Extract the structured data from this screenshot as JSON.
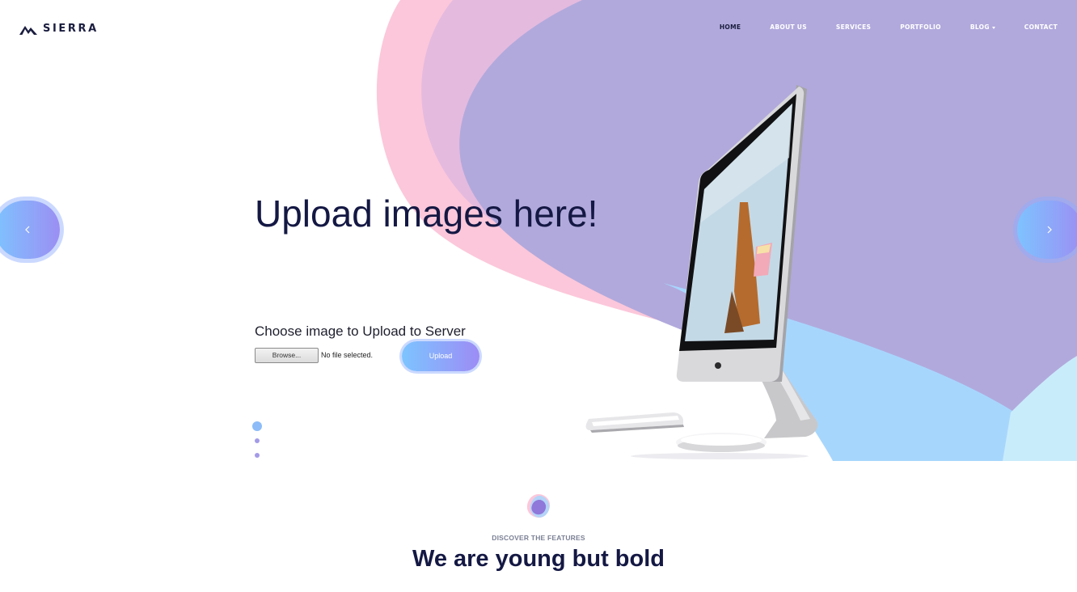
{
  "brand": {
    "name": "SIERRA",
    "logo_icon": "mountain-icon"
  },
  "nav": {
    "items": [
      {
        "label": "HOME",
        "active": true
      },
      {
        "label": "ABOUT US",
        "active": false
      },
      {
        "label": "SERVICES",
        "active": false
      },
      {
        "label": "PORTFOLIO",
        "active": false
      },
      {
        "label": "BLOG",
        "active": false,
        "has_dropdown": true
      },
      {
        "label": "CONTACT",
        "active": false
      }
    ]
  },
  "hero": {
    "title": "Upload images here!",
    "upload_label": "Choose image to Upload to Server",
    "browse_label": "Browse...",
    "file_status": "No file selected.",
    "upload_button": "Upload",
    "slide_count": 3,
    "active_slide": 1
  },
  "features": {
    "kicker": "DISCOVER THE FEATURES",
    "title": "We are young but bold"
  },
  "colors": {
    "pink": "#fcc7da",
    "lavender": "#b1a9dc",
    "sky": "#a7d6fd",
    "navy": "#141843",
    "button_start": "#7dc4ff",
    "button_end": "#9c8cf5"
  }
}
